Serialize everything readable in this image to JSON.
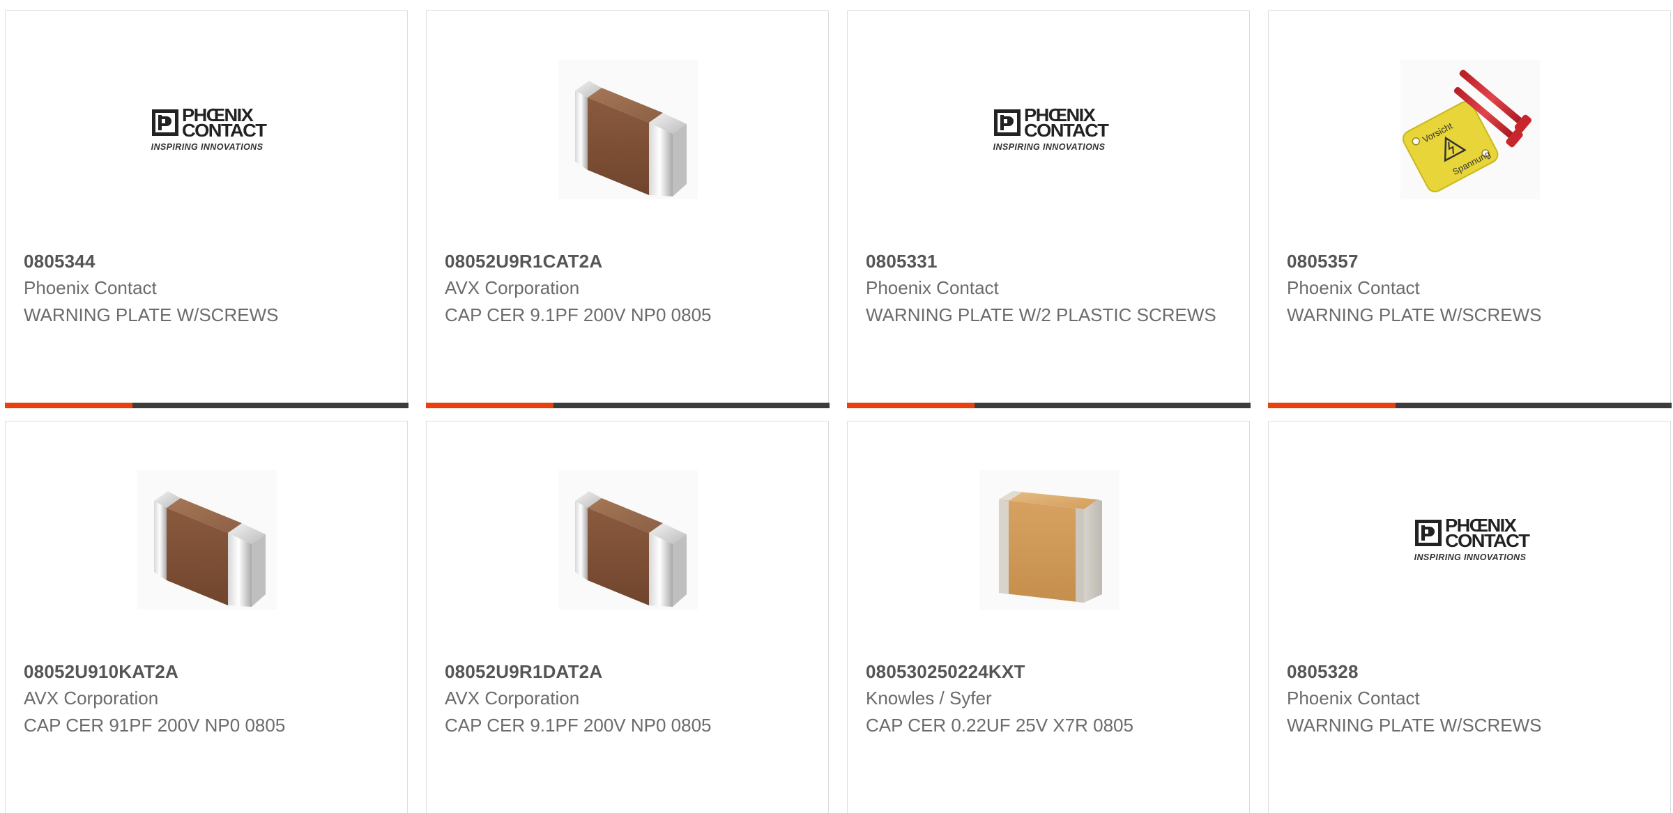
{
  "products": [
    {
      "part_number": "0805344",
      "manufacturer": "Phoenix Contact",
      "description": "WARNING PLATE W/SCREWS",
      "image": "phoenix-contact-logo"
    },
    {
      "part_number": "08052U9R1CAT2A",
      "manufacturer": "AVX Corporation",
      "description": "CAP CER 9.1PF 200V NP0 0805",
      "image": "brown-ceramic-capacitor"
    },
    {
      "part_number": "0805331",
      "manufacturer": "Phoenix Contact",
      "description": "WARNING PLATE W/2 PLASTIC SCREWS",
      "image": "phoenix-contact-logo"
    },
    {
      "part_number": "0805357",
      "manufacturer": "Phoenix Contact",
      "description": "WARNING PLATE W/SCREWS",
      "image": "yellow-warning-plate-with-red-screws"
    },
    {
      "part_number": "08052U910KAT2A",
      "manufacturer": "AVX Corporation",
      "description": "CAP CER 91PF 200V NP0 0805",
      "image": "brown-ceramic-capacitor"
    },
    {
      "part_number": "08052U9R1DAT2A",
      "manufacturer": "AVX Corporation",
      "description": "CAP CER 9.1PF 200V NP0 0805",
      "image": "brown-ceramic-capacitor"
    },
    {
      "part_number": "080530250224KXT",
      "manufacturer": "Knowles / Syfer",
      "description": "CAP CER 0.22UF 25V X7R 0805",
      "image": "tan-ceramic-capacitor"
    },
    {
      "part_number": "0805328",
      "manufacturer": "Phoenix Contact",
      "description": "WARNING PLATE W/SCREWS",
      "image": "phoenix-contact-logo"
    }
  ],
  "logo": {
    "line1": "PHŒNIX",
    "line2": "CONTACT",
    "tagline": "INSPIRING INNOVATIONS"
  },
  "warning_plate": {
    "text1": "Vorsicht",
    "text2": "Spannung"
  },
  "colors": {
    "accent": "#e8410f",
    "bar": "#3c3c3c",
    "part_number": "#555555",
    "text": "#6b6b6b",
    "border": "#dcdcdc"
  }
}
